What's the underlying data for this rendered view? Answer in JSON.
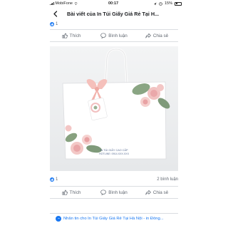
{
  "status_bar": {
    "carrier": "MobiFone",
    "time": "00:17",
    "battery": "15%"
  },
  "header": {
    "title": "Bài viết của In Túi Giấy Giá Rẻ Tại H..."
  },
  "post": {
    "like_count": "1",
    "comment_count": "2 bình luận",
    "photo_watermark_line1": "IN TÚI GIẤY CAO CẤP",
    "photo_watermark_line2": "HOTLINE: 0914.XXX.XXX"
  },
  "actions": {
    "like": "Thích",
    "comment": "Bình luận",
    "share": "Chia sẻ"
  },
  "message_bar": {
    "text": "Nhắn tin cho In Túi Giấy Giá Rẻ Tại Hà Nội - in Đồng..."
  },
  "colors": {
    "accent": "#1877f2",
    "muted_text": "#606770",
    "bag": "#ffffff",
    "bow": "#f2b8b4",
    "rose": "#f1c3c2",
    "leaf": "#7f9a7a"
  },
  "icons": {
    "back": "chevron-left-icon",
    "like": "thumbs-up-icon",
    "comment": "speech-bubble-icon",
    "share": "share-arrow-icon",
    "messenger": "messenger-icon"
  }
}
